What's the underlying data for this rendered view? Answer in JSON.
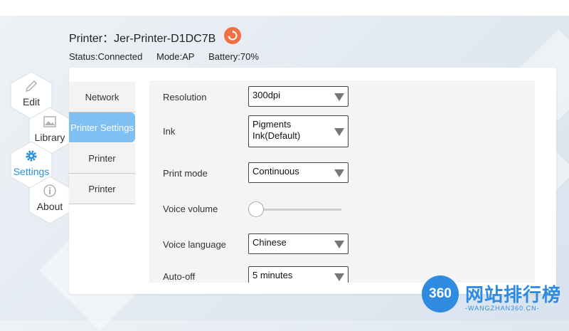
{
  "header": {
    "printer_title": "Printer：Jer-Printer-D1DC7B",
    "status": "Status:Connected",
    "mode": "Mode:AP",
    "battery": "Battery:70%",
    "refresh_icon": "refresh-icon"
  },
  "nav": {
    "items": [
      {
        "label": "Edit",
        "icon": "pencil-icon",
        "active": false
      },
      {
        "label": "Library",
        "icon": "image-icon",
        "active": false
      },
      {
        "label": "Settings",
        "icon": "gear-icon",
        "active": true
      },
      {
        "label": "About",
        "icon": "info-icon",
        "active": false
      }
    ]
  },
  "tabs": [
    {
      "label": "Network",
      "active": false
    },
    {
      "label": "Printer Settings",
      "active": true
    },
    {
      "label": "Printer",
      "active": false
    },
    {
      "label": "Printer",
      "active": false
    }
  ],
  "settings": {
    "resolution": {
      "label": "Resolution",
      "value": "300dpi"
    },
    "ink": {
      "label": "Ink",
      "value_line1": "Pigments",
      "value_line2": "Ink(Default)"
    },
    "print_mode": {
      "label": "Print mode",
      "value": "Continuous"
    },
    "voice_volume": {
      "label": "Voice volume",
      "level": 0
    },
    "voice_language": {
      "label": "Voice language",
      "value": "Chinese"
    },
    "auto_off": {
      "label": "Auto-off",
      "value": "5 minutes"
    }
  },
  "watermark": {
    "badge": "360",
    "name": "网站排行榜",
    "url": "-WANGZHAN360.CN-"
  },
  "colors": {
    "accent": "#2b8fd6",
    "tab_active": "#7fbff2",
    "refresh": "#f07043"
  }
}
